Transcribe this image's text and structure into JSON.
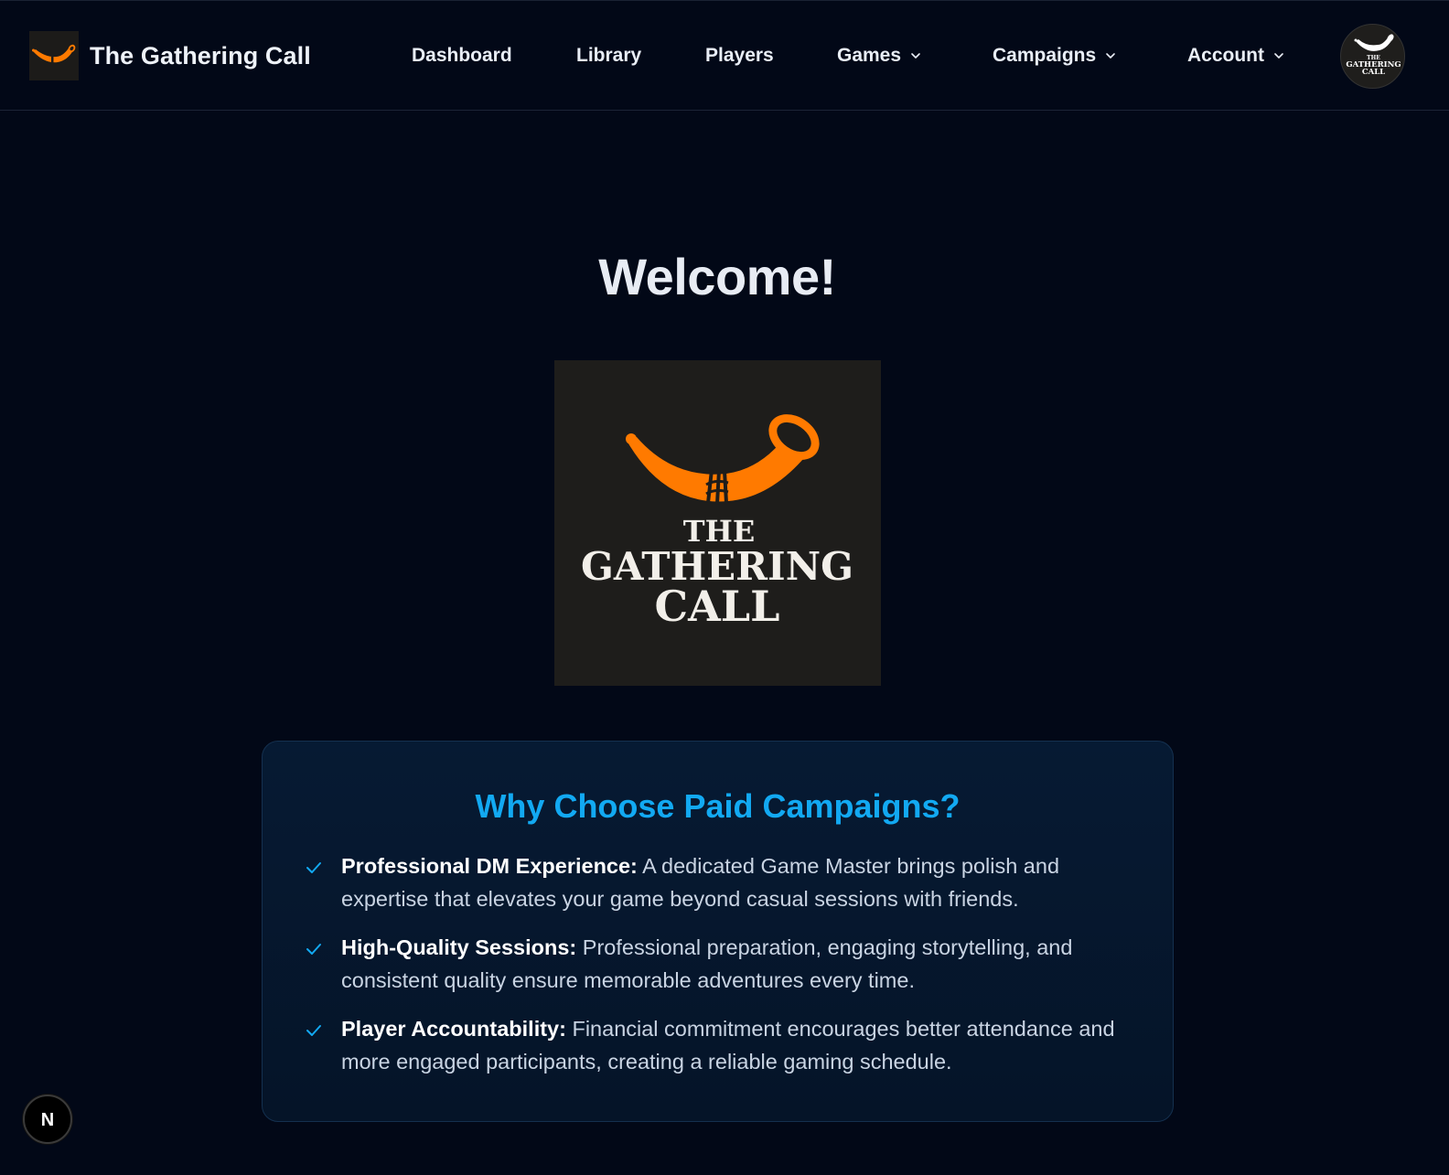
{
  "brand": {
    "title": "The Gathering Call",
    "icon": "horn-icon",
    "accent_color": "#ff7a00"
  },
  "nav": {
    "links": [
      {
        "label": "Dashboard",
        "has_dropdown": false
      },
      {
        "label": "Library",
        "has_dropdown": false
      },
      {
        "label": "Players",
        "has_dropdown": false
      },
      {
        "label": "Games",
        "has_dropdown": true
      },
      {
        "label": "Campaigns",
        "has_dropdown": true
      },
      {
        "label": "Account",
        "has_dropdown": true
      }
    ],
    "avatar": {
      "line1": "THE",
      "line2": "GATHERING",
      "line3": "CALL"
    }
  },
  "main": {
    "heading": "Welcome!",
    "hero_logo": {
      "line1": "THE",
      "line2": "GATHERING",
      "line3": "CALL"
    },
    "card": {
      "title": "Why Choose Paid Campaigns?",
      "title_color": "#12a9f2",
      "benefits": [
        {
          "title": "Professional DM Experience:",
          "text": " A dedicated Game Master brings polish and expertise that elevates your game beyond casual sessions with friends."
        },
        {
          "title": "High-Quality Sessions:",
          "text": " Professional preparation, engaging storytelling, and consistent quality ensure memorable adventures every time."
        },
        {
          "title": "Player Accountability:",
          "text": " Financial commitment encourages better attendance and more engaged participants, creating a reliable gaming schedule."
        }
      ]
    }
  },
  "dev_badge": {
    "letter": "N"
  }
}
